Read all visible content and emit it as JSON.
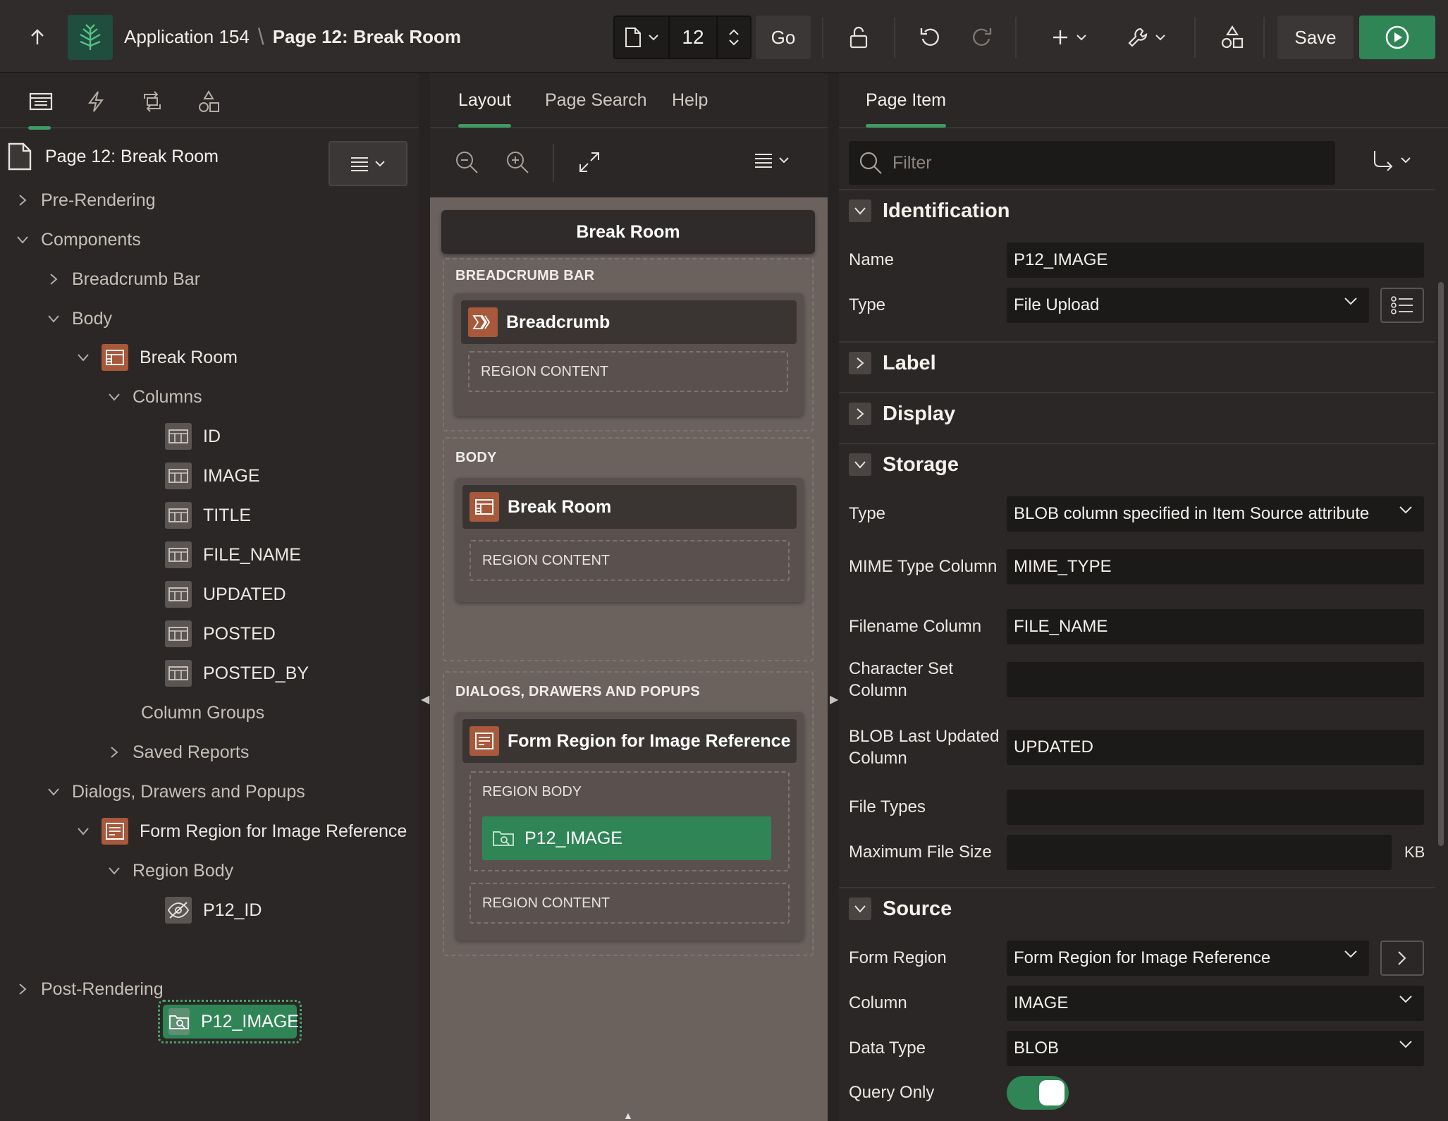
{
  "header": {
    "app_name": "Application 154",
    "separator": "\\",
    "page_title": "Page 12: Break Room",
    "page_number": "12",
    "go_label": "Go",
    "save_label": "Save"
  },
  "left": {
    "root": "Page 12: Break Room",
    "nodes": {
      "pre_rendering": "Pre-Rendering",
      "components": "Components",
      "breadcrumb_bar": "Breadcrumb Bar",
      "body": "Body",
      "break_room": "Break Room",
      "columns": "Columns",
      "col_id": "ID",
      "col_image": "IMAGE",
      "col_title": "TITLE",
      "col_file_name": "FILE_NAME",
      "col_updated": "UPDATED",
      "col_posted": "POSTED",
      "col_posted_by": "POSTED_BY",
      "column_groups": "Column Groups",
      "saved_reports": "Saved Reports",
      "dialogs": "Dialogs, Drawers and Popups",
      "form_region": "Form Region for Image Reference",
      "region_body": "Region Body",
      "p12_id": "P12_ID",
      "p12_image": "P12_IMAGE",
      "post_rendering": "Post-Rendering"
    }
  },
  "center": {
    "tabs": {
      "layout": "Layout",
      "page_search": "Page Search",
      "help": "Help"
    },
    "page_header": "Break Room",
    "breadcrumb_bar": {
      "label": "BREADCRUMB BAR",
      "region_title": "Breadcrumb",
      "content": "REGION CONTENT"
    },
    "body": {
      "label": "BODY",
      "region_title": "Break Room",
      "content": "REGION CONTENT"
    },
    "dialogs": {
      "label": "DIALOGS, DRAWERS AND POPUPS",
      "region_title": "Form Region for Image Reference",
      "region_body": "REGION BODY",
      "item": "P12_IMAGE",
      "content": "REGION CONTENT"
    }
  },
  "right": {
    "tab": "Page Item",
    "filter_placeholder": "Filter",
    "sections": {
      "identification": "Identification",
      "label": "Label",
      "display": "Display",
      "storage": "Storage",
      "source": "Source"
    },
    "props": {
      "name_label": "Name",
      "name_value": "P12_IMAGE",
      "type_label": "Type",
      "type_value": "File Upload",
      "storage_type_label": "Type",
      "storage_type_value": "BLOB column specified in Item Source attribute",
      "mime_label": "MIME Type Column",
      "mime_value": "MIME_TYPE",
      "filename_label": "Filename Column",
      "filename_value": "FILE_NAME",
      "charset_label": "Character Set Column",
      "charset_value": "",
      "blob_updated_label": "BLOB Last Updated Column",
      "blob_updated_value": "UPDATED",
      "file_types_label": "File Types",
      "file_types_value": "",
      "max_size_label": "Maximum File Size",
      "max_size_value": "",
      "max_size_unit": "KB",
      "form_region_label": "Form Region",
      "form_region_value": "Form Region for Image Reference",
      "column_label": "Column",
      "column_value": "IMAGE",
      "data_type_label": "Data Type",
      "data_type_value": "BLOB",
      "query_only_label": "Query Only",
      "query_only_value": true
    }
  },
  "colors": {
    "accent": "#3f9a64",
    "run_button": "#2f8556",
    "region_icon": "#a8583b"
  }
}
